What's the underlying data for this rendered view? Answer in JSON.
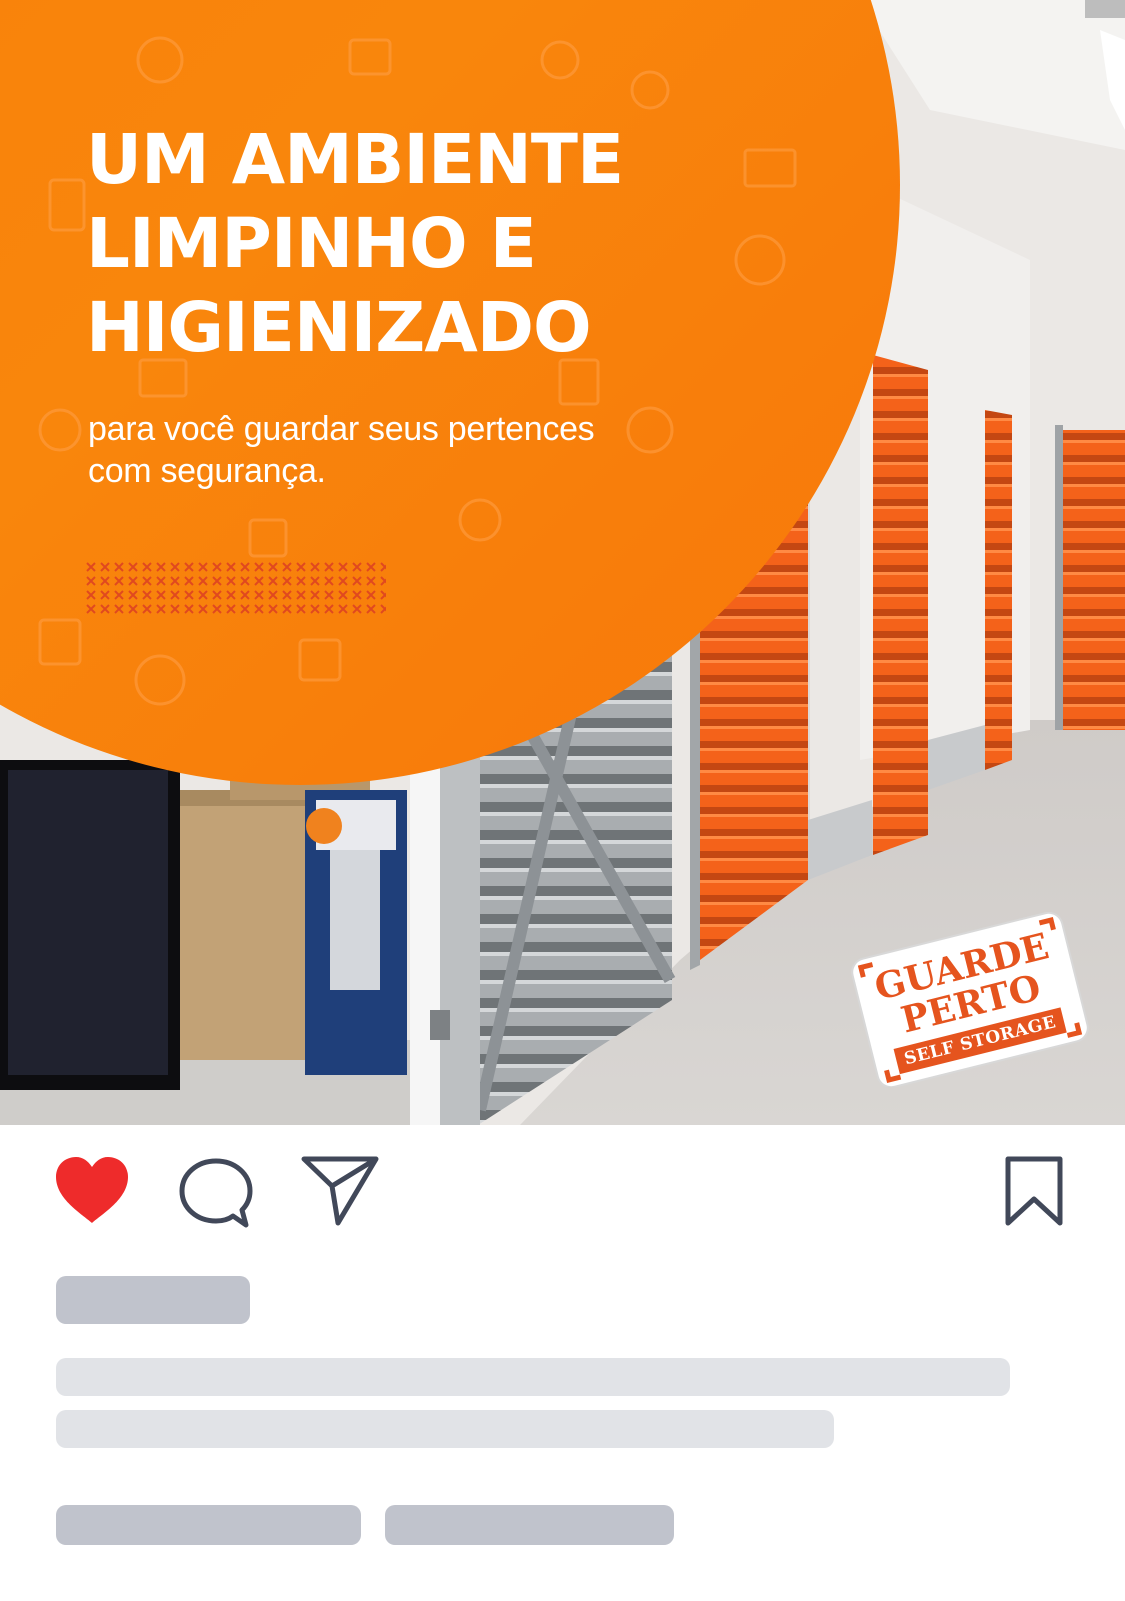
{
  "post": {
    "media": {
      "headline_lines": [
        "UM AMBIENTE",
        "LIMPINHO E",
        "HIGIENIZADO"
      ],
      "subheadline": "para você guardar seus pertences com segurança.",
      "brand": {
        "line1": "GUARDE",
        "line2": "PERTO",
        "line3": "SELF STORAGE"
      },
      "colors": {
        "accent_orange": "#f58a0c",
        "door_orange": "#f3641c",
        "brand_orange": "#e5541e"
      }
    },
    "actions": {
      "like": {
        "icon": "heart-icon",
        "state": "liked",
        "color": "#ee2b2b"
      },
      "comment": {
        "icon": "comment-icon"
      },
      "share": {
        "icon": "send-icon"
      },
      "save": {
        "icon": "bookmark-icon"
      }
    }
  }
}
